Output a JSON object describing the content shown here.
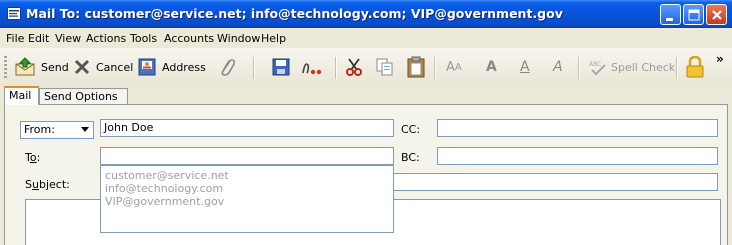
{
  "window": {
    "title": "Mail To: customer@service.net; info@technology.com; VIP@government.gov",
    "controls": [
      "minimize-icon",
      "maximize-icon",
      "close-icon"
    ]
  },
  "menu": {
    "items": [
      "File",
      "Edit",
      "View",
      "Actions",
      "Tools",
      "Accounts",
      "Window",
      "Help"
    ]
  },
  "toolbar": {
    "send_label": "Send",
    "cancel_label": "Cancel",
    "address_label": "Address",
    "spell_check_label": "Spell Check",
    "font_a_labels": [
      "A",
      "A",
      "A",
      "A"
    ],
    "overflow_label": "»"
  },
  "tabs": [
    {
      "label": "Mail",
      "active": true
    },
    {
      "label": "Send Options",
      "active": false
    }
  ],
  "form": {
    "from_label": "From:",
    "from_value": "John Doe",
    "cc_label": "CC:",
    "cc_value": "",
    "to_label": "To:",
    "to_value": "",
    "bc_label": "BC:",
    "bc_value": "",
    "subject_label": "Subject:",
    "subject_value": "",
    "to_suggestions": [
      "customer@service.net",
      "info@technology.com",
      "VIP@government.gov"
    ]
  },
  "colors": {
    "titlebar": "#0a5fe8",
    "tab_highlight": "#e68b2c",
    "input_border": "#7f9db9"
  }
}
